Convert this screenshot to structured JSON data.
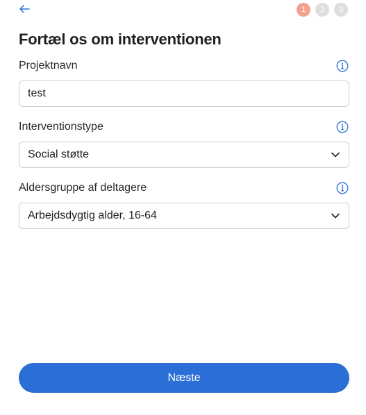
{
  "header": {
    "back_icon": "arrow-left-icon",
    "steps": [
      {
        "label": "1",
        "state": "active"
      },
      {
        "label": "2",
        "state": "inactive"
      },
      {
        "label": "3",
        "state": "inactive"
      }
    ]
  },
  "page": {
    "title": "Fortæl os om interventionen"
  },
  "form": {
    "project_name": {
      "label": "Projektnavn",
      "value": "test",
      "info_icon": "info-icon"
    },
    "intervention_type": {
      "label": "Interventionstype",
      "selected": "Social støtte",
      "info_icon": "info-icon"
    },
    "age_group": {
      "label": "Aldersgruppe af deltagere",
      "selected": "Arbejdsdygtig alder, 16-64",
      "info_icon": "info-icon"
    }
  },
  "footer": {
    "next_label": "Næste"
  },
  "colors": {
    "accent": "#2b6fd6",
    "step_active": "#f2a28e",
    "step_inactive": "#dedede",
    "border": "#cfcfcf"
  }
}
